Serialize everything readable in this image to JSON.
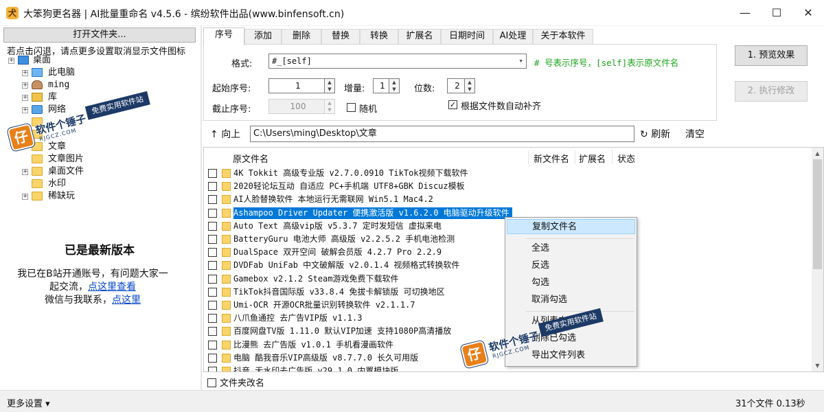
{
  "window": {
    "title": "大笨狗更名器 | AI批量重命名 v4.5.6 - 缤纷软件出品(www.binfensoft.cn)",
    "minimize": "—",
    "maximize": "☐",
    "close": "✕"
  },
  "left": {
    "open_folder": "打开文件夹...",
    "hint": "若点击闪退，请点更多设置取消显示文件图标",
    "tree": [
      {
        "label": "桌面",
        "icon": "desktop-icon"
      },
      {
        "label": "此电脑",
        "icon": "computer-icon"
      },
      {
        "label": "ming",
        "icon": "user-icon"
      },
      {
        "label": "库",
        "icon": "library-icon"
      },
      {
        "label": "网络",
        "icon": "network-icon"
      },
      {
        "label": "",
        "icon": "folder-icon"
      },
      {
        "label": "",
        "icon": "folder-icon"
      },
      {
        "label": "文章",
        "icon": "folder-icon"
      },
      {
        "label": "文章图片",
        "icon": "folder-icon"
      },
      {
        "label": "桌面文件",
        "icon": "folder-icon"
      },
      {
        "label": "水印",
        "icon": "folder-icon"
      },
      {
        "label": "稀缺玩",
        "icon": "folder-icon"
      }
    ],
    "version_title": "已是最新版本",
    "info_line1": "我已在B站开通账号，有问题大家一",
    "info_line2_prefix": "起交流，",
    "info_line2_link": "点这里查看",
    "info_line3_prefix": "微信与我联系，",
    "info_line3_link": "点这里"
  },
  "tabs": [
    "序号",
    "添加",
    "删除",
    "替换",
    "转换",
    "扩展名",
    "日期时间",
    "AI处理",
    "关于本软件"
  ],
  "seq_panel": {
    "format_label": "格式:",
    "format_value": "#_[self]",
    "format_hint": "# 号表示序号，[self]表示原文件名",
    "start_label": "起始序号:",
    "start_value": "1",
    "step_label": "增量:",
    "step_value": "1",
    "digits_label": "位数:",
    "digits_value": "2",
    "end_label": "截止序号:",
    "end_value": "100",
    "random_label": "随机",
    "autopad_label": "根据文件数自动补齐",
    "autopad_check": "✓"
  },
  "actions": {
    "preview": "1. 预览效果",
    "execute": "2. 执行修改"
  },
  "pathbar": {
    "up": "向上",
    "path": "C:\\Users\\ming\\Desktop\\文章",
    "refresh": "刷新",
    "clear": "清空"
  },
  "list": {
    "columns": [
      "原文件名",
      "新文件名",
      "扩展名",
      "状态"
    ],
    "files": [
      "4K Tokkit 高级专业版 v2.7.0.0910 TikTok视频下载软件",
      "2020轻论坛互动 自适应 PC+手机端 UTF8+GBK Discuz模板",
      "AI人脸替换软件 本地运行无需联网 Win5.1  Mac4.2",
      "Ashampoo Driver Updater 便携激活版 v1.6.2.0 电脑驱动升级软件",
      "Auto Text 高级vip版 v5.3.7 定时发短信 虚拟来电",
      "BatteryGuru 电池大师 高级版 v2.2.5.2 手机电池检测",
      "DualSpace 双开空间 破解会员版 4.2.7  Pro 2.2.9",
      "DVDFab UniFab 中文破解版 v2.0.1.4 视频格式转换软件",
      "Gamebox v2.1.2 Steam游戏免费下载软件",
      "TikTok抖音国际版 v33.8.4 免拔卡解锁版 可切换地区",
      "Umi-OCR 开源OCR批量识别转换软件 v2.1.1.7",
      "八爪鱼通控 去广告VIP版 v1.1.3",
      "百度网盘TV版 1.11.0 默认VIP加速 支持1080P高清播放",
      "比漫熊 去广告版 v1.0.1 手机看漫画软件",
      "电脑 酷我音乐VIP高级版 v8.7.7.0 长久可用版",
      "抖音 无水印去广告版 v29.1.0 内置模块版"
    ],
    "selected_index": 3
  },
  "context_menu": [
    "复制文件名",
    "全选",
    "反选",
    "勾选",
    "取消勾选",
    "从列表中",
    "删除已勾选",
    "导出文件列表"
  ],
  "folder_rename_label": "文件夹改名",
  "status": {
    "more_settings": "更多设置 ▾",
    "count": "31个文件  0.13秒"
  },
  "watermark": {
    "name": "软件个锤子",
    "url": "RJGCZ.COM",
    "slogan": "免费实用软件站",
    "logo_glyph": "仔"
  },
  "icons": {
    "app": "dog-app-icon",
    "up": "↑",
    "refresh": "↻",
    "scroll_up": "▲",
    "scroll_down": "▼",
    "spin_up": "▲",
    "spin_down": "▼",
    "dropdown": "▾",
    "tree_expand": "+"
  }
}
